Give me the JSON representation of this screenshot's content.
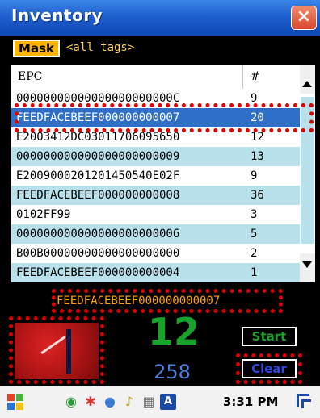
{
  "window": {
    "title": "Inventory",
    "close_label": "×"
  },
  "mask": {
    "button_label": "Mask",
    "value": "<all tags>"
  },
  "list": {
    "columns": [
      "EPC",
      "#"
    ],
    "rows": [
      {
        "epc": "00000000000000000000000C",
        "count": "9"
      },
      {
        "epc": "FEEDFACEBEEF000000000007",
        "count": "20"
      },
      {
        "epc": "E2003412DC03011706095650",
        "count": "12"
      },
      {
        "epc": "000000000000000000000009",
        "count": "13"
      },
      {
        "epc": "E2009000201201450540E02F",
        "count": "9"
      },
      {
        "epc": "FEEDFACEBEEF000000000008",
        "count": "36"
      },
      {
        "epc": "0102FF99",
        "count": "3"
      },
      {
        "epc": "000000000000000000000006",
        "count": "5"
      },
      {
        "epc": "B00B00000000000000000000",
        "count": "2"
      },
      {
        "epc": "FEEDFACEBEEF000000000004",
        "count": "1"
      }
    ],
    "selected_index": 1
  },
  "status": {
    "last_tag": "FEEDFACEBEEF000000000007",
    "unique_count": "12",
    "total_reads": "258"
  },
  "buttons": {
    "start": "Start",
    "clear": "Clear"
  },
  "taskbar": {
    "time": "3:31 PM"
  },
  "colors": {
    "title_bar": "#1f5fcf",
    "selected_row": "#2f6fc8",
    "alt_row": "#b9e1ec",
    "highlight": "#e00000",
    "count_green": "#1aa32a",
    "reads_blue": "#4d7fe0",
    "tag_orange": "#ffa500"
  }
}
